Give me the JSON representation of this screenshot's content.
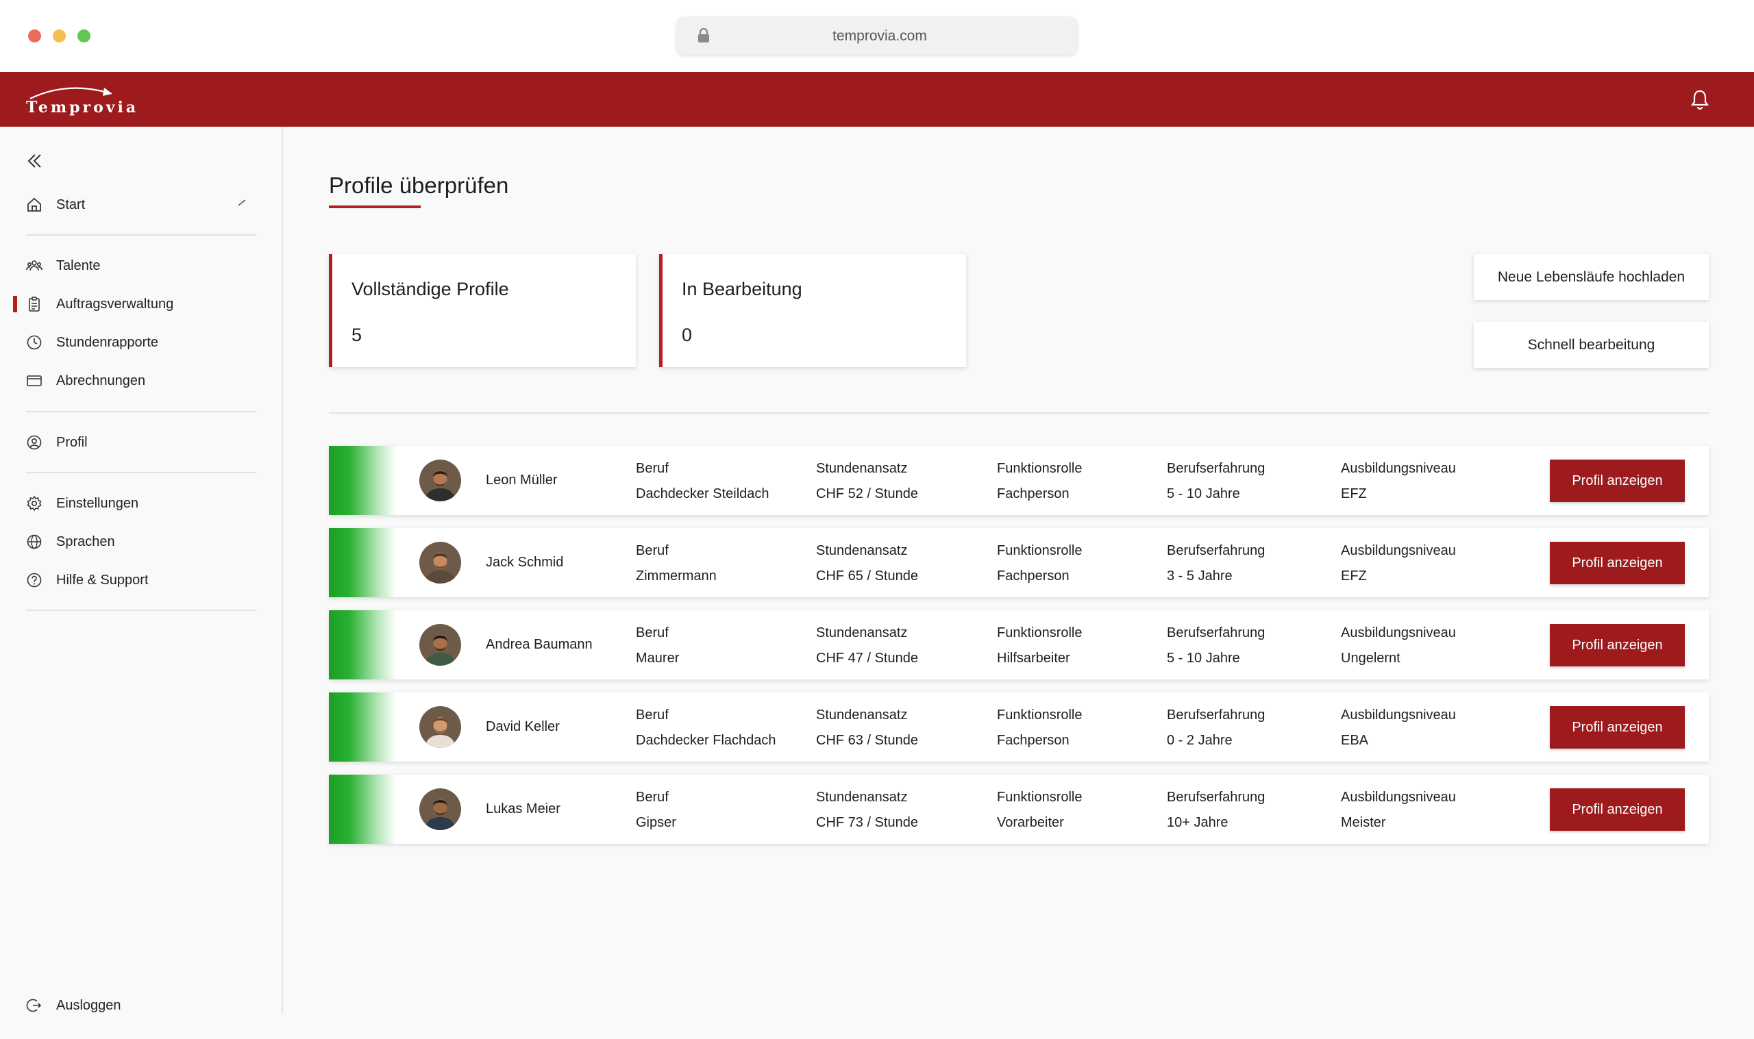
{
  "browser": {
    "url": "temprovia.com"
  },
  "app": {
    "brand": "Temprovia"
  },
  "sidebar": {
    "items": [
      {
        "label": "Start",
        "icon": "home-icon"
      },
      {
        "label": "Talente",
        "icon": "people-icon"
      },
      {
        "label": "Auftragsverwaltung",
        "icon": "clipboard-icon",
        "active": true
      },
      {
        "label": "Stundenrapporte",
        "icon": "clock-icon"
      },
      {
        "label": "Abrechnungen",
        "icon": "card-icon"
      },
      {
        "label": "Profil",
        "icon": "user-circle-icon"
      },
      {
        "label": "Einstellungen",
        "icon": "gear-icon"
      },
      {
        "label": "Sprachen",
        "icon": "globe-icon"
      },
      {
        "label": "Hilfe & Support",
        "icon": "help-icon"
      }
    ],
    "logout": "Ausloggen"
  },
  "main": {
    "title": "Profile überprüfen",
    "stats": [
      {
        "label": "Vollständige Profile",
        "value": "5"
      },
      {
        "label": "In Bearbeitung",
        "value": "0"
      }
    ],
    "actions": {
      "upload": "Neue Lebensläufe hochladen",
      "quick_edit": "Schnell bearbeitung"
    },
    "columns": {
      "beruf": "Beruf",
      "rate": "Stundenansatz",
      "role": "Funktionsrolle",
      "experience": "Berufserfahrung",
      "education": "Ausbildungsniveau"
    },
    "button_label": "Profil anzeigen",
    "profiles": [
      {
        "name": "Leon Müller",
        "beruf": "Dachdecker Steildach",
        "rate": "CHF 52 / Stunde",
        "role": "Fachperson",
        "experience": "5 - 10 Jahre",
        "education": "EFZ"
      },
      {
        "name": "Jack Schmid",
        "beruf": "Zimmermann",
        "rate": "CHF 65 / Stunde",
        "role": "Fachperson",
        "experience": "3 - 5 Jahre",
        "education": "EFZ"
      },
      {
        "name": "Andrea Baumann",
        "beruf": "Maurer",
        "rate": "CHF 47 / Stunde",
        "role": "Hilfsarbeiter",
        "experience": "5 - 10 Jahre",
        "education": "Ungelernt"
      },
      {
        "name": "David Keller",
        "beruf": "Dachdecker Flachdach",
        "rate": "CHF 63 / Stunde",
        "role": "Fachperson",
        "experience": "0 - 2 Jahre",
        "education": "EBA"
      },
      {
        "name": "Lukas Meier",
        "beruf": "Gipser",
        "rate": "CHF 73 / Stunde",
        "role": "Vorarbeiter",
        "experience": "10+ Jahre",
        "education": "Meister"
      }
    ]
  },
  "colors": {
    "brand": "#9d1a1d",
    "accent": "#b32024",
    "status_complete": "#1e9e28"
  }
}
